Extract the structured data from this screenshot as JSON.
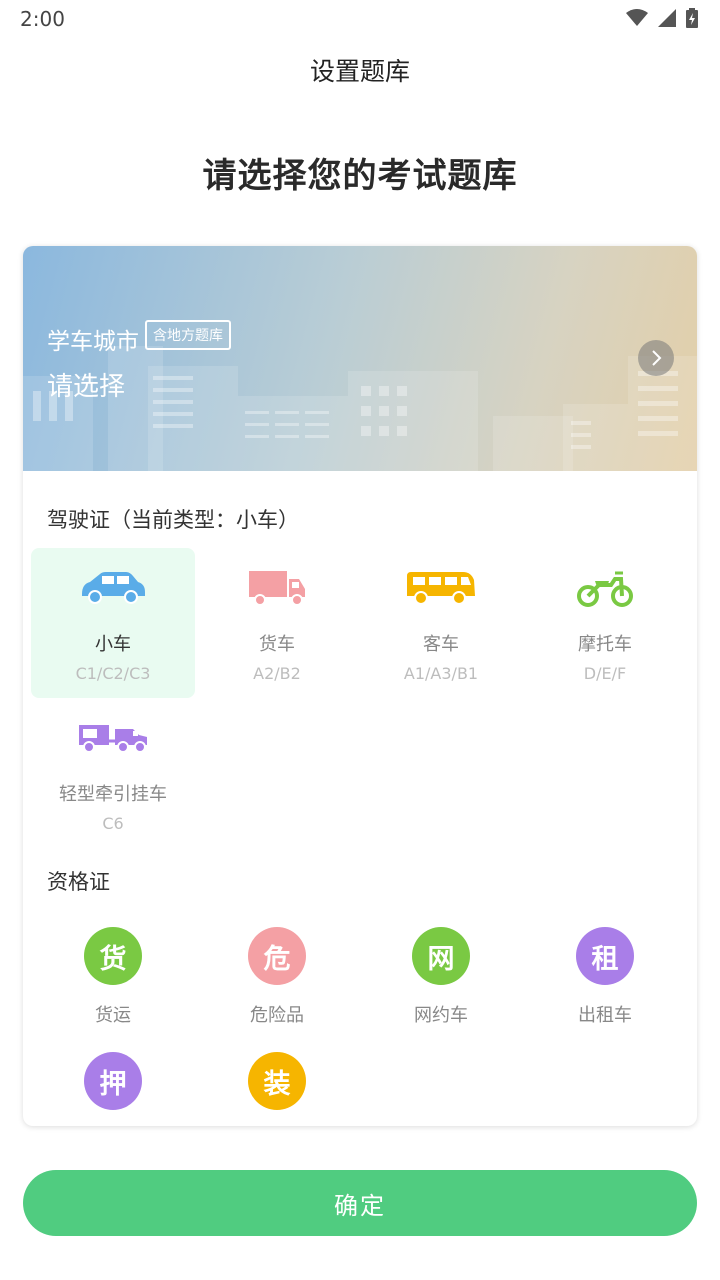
{
  "status_bar": {
    "time": "2:00"
  },
  "nav": {
    "title": "设置题库"
  },
  "headline": "请选择您的考试题库",
  "city": {
    "label": "学车城市",
    "tag": "含地方题库",
    "value": "请选择"
  },
  "license": {
    "section_title": "驾驶证（当前类型：小车）",
    "items": [
      {
        "name": "小车",
        "code": "C1/C2/C3",
        "icon": "car-icon",
        "color": "#5aace8",
        "selected": true
      },
      {
        "name": "货车",
        "code": "A2/B2",
        "icon": "truck-icon",
        "color": "#f4a0a4"
      },
      {
        "name": "客车",
        "code": "A1/A3/B1",
        "icon": "bus-icon",
        "color": "#f6b500"
      },
      {
        "name": "摩托车",
        "code": "D/E/F",
        "icon": "motorcycle-icon",
        "color": "#7ac943"
      },
      {
        "name": "轻型牵引挂车",
        "code": "C6",
        "icon": "trailer-icon",
        "color": "#a97ee8"
      }
    ]
  },
  "certificate": {
    "section_title": "资格证",
    "items": [
      {
        "glyph": "货",
        "name": "货运",
        "color": "#7ac943"
      },
      {
        "glyph": "危",
        "name": "危险品",
        "color": "#f4a0a4"
      },
      {
        "glyph": "网",
        "name": "网约车",
        "color": "#7ac943"
      },
      {
        "glyph": "租",
        "name": "出租车",
        "color": "#a97ee8"
      },
      {
        "glyph": "押",
        "name": "",
        "color": "#a97ee8"
      },
      {
        "glyph": "装",
        "name": "",
        "color": "#f6b500"
      }
    ]
  },
  "confirm_label": "确定",
  "colors": {
    "accent": "#50cc80",
    "selected_bg": "#e9fbf1"
  }
}
